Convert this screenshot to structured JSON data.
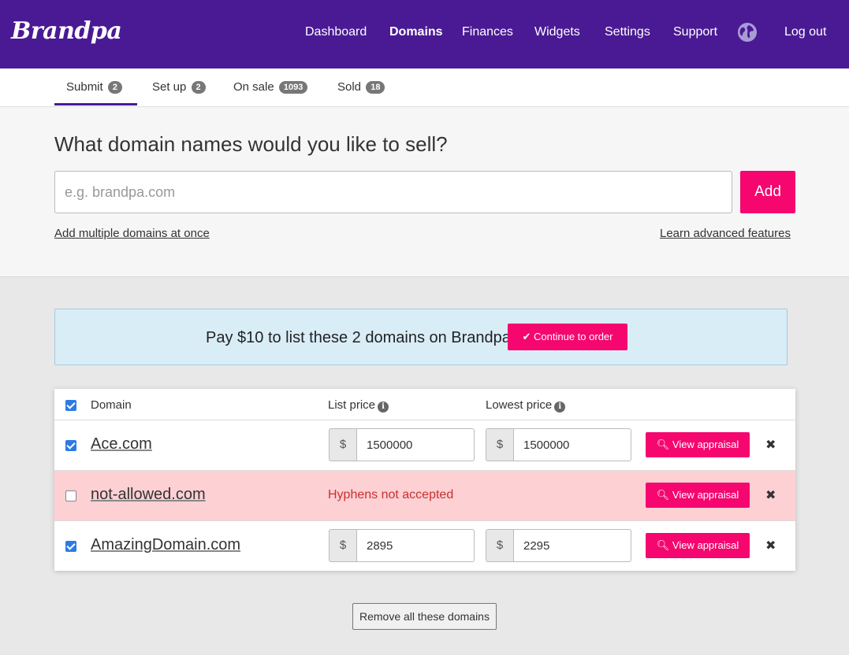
{
  "brand": {
    "logo": "Brandpa",
    "accent": "#f5076f",
    "nav_bg": "#4a1a94"
  },
  "nav": {
    "items": [
      "Dashboard",
      "Domains",
      "Finances",
      "Widgets",
      "Settings",
      "Support"
    ],
    "active": "Domains",
    "logout": "Log out",
    "globe_icon": "globe-icon"
  },
  "tabs": [
    {
      "label": "Submit",
      "count": "2",
      "active": true
    },
    {
      "label": "Set up",
      "count": "2",
      "active": false
    },
    {
      "label": "On sale",
      "count": "1093",
      "active": false
    },
    {
      "label": "Sold",
      "count": "18",
      "active": false
    }
  ],
  "submit": {
    "headline": "What domain names would you like to sell?",
    "placeholder": "e.g. brandpa.com",
    "value": "",
    "add_label": "Add",
    "multiple_link": "Add multiple domains at once",
    "advanced_link": "Learn advanced features"
  },
  "pay_banner": {
    "text": "Pay $10 to list these 2 domains on Brandpa",
    "button": "Continue to order"
  },
  "table": {
    "headers": {
      "domain": "Domain",
      "list_price": "List price",
      "lowest_price": "Lowest price"
    },
    "all_checked": true,
    "currency": "$",
    "appraisal_label": "View appraisal",
    "rows": [
      {
        "domain": "Ace.com",
        "checked": true,
        "list_price": "1500000",
        "lowest_price": "1500000",
        "error": ""
      },
      {
        "domain": "not-allowed.com",
        "checked": false,
        "list_price": "",
        "lowest_price": "",
        "error": "Hyphens not accepted"
      },
      {
        "domain": "AmazingDomain.com",
        "checked": true,
        "list_price": "2895",
        "lowest_price": "2295",
        "error": ""
      }
    ]
  },
  "remove_all": "Remove all these domains"
}
